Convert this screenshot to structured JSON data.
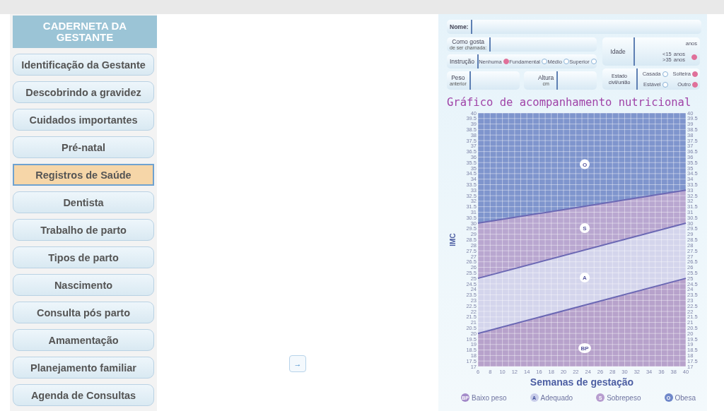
{
  "sidebar": {
    "title": "CADERNETA DA GESTANTE",
    "items": [
      {
        "label": "Identificação da Gestante",
        "selected": false
      },
      {
        "label": "Descobrindo a gravidez",
        "selected": false
      },
      {
        "label": "Cuidados importantes",
        "selected": false
      },
      {
        "label": "Pré-natal",
        "selected": false
      },
      {
        "label": "Registros de Saúde",
        "selected": true
      },
      {
        "label": "Dentista",
        "selected": false
      },
      {
        "label": "Trabalho de parto",
        "selected": false
      },
      {
        "label": "Tipos de parto",
        "selected": false
      },
      {
        "label": "Nascimento",
        "selected": false
      },
      {
        "label": "Consulta pós parto",
        "selected": false
      },
      {
        "label": "Amamentação",
        "selected": false
      },
      {
        "label": "Planejamento familiar",
        "selected": false
      },
      {
        "label": "Agenda de Consultas",
        "selected": false
      }
    ]
  },
  "next_button": {
    "label": "→"
  },
  "form": {
    "name_label": "Nome:",
    "nickname_label": "Como gosta",
    "nickname_sub": "de ser chamada:",
    "education": {
      "label": "Instrução",
      "options": [
        {
          "label": "Nenhuma",
          "marked": true
        },
        {
          "label": "Fundamental",
          "marked": false
        },
        {
          "label": "Médio",
          "marked": false
        },
        {
          "label": "Superior",
          "marked": false
        }
      ]
    },
    "weight_label": "Peso",
    "weight_sub": "anterior",
    "height_label": "Altura",
    "height_sub": "cm",
    "age": {
      "label": "Idade",
      "unit": "anos",
      "risk_low": "<15",
      "risk_high": ">35",
      "risk_unit_1": "anos",
      "risk_unit_2": "anos",
      "marked": true
    },
    "marital": {
      "label_1": "Estado",
      "label_2": "civil/união",
      "options": [
        {
          "label": "Casada",
          "marked": false
        },
        {
          "label": "Solteira",
          "marked": true
        },
        {
          "label": "Estável",
          "marked": false
        },
        {
          "label": "Outro",
          "marked": true
        }
      ]
    }
  },
  "chart": {
    "title": "Gráfico de acompanhamento nutricional",
    "chart_data": {
      "type": "line",
      "xlabel": "Semanas de gestação",
      "ylabel": "IMC",
      "x": [
        6,
        40
      ],
      "series": [
        {
          "color": "#6b68b4",
          "values": [
            20,
            25
          ]
        },
        {
          "color": "#6b68b4",
          "values": [
            25,
            30
          ]
        },
        {
          "color": "#6b68b4",
          "values": [
            30,
            33
          ]
        }
      ],
      "grid": true,
      "xlim": [
        6,
        40
      ],
      "ylim": [
        17,
        40
      ],
      "xticks": [
        6,
        8,
        10,
        12,
        14,
        16,
        18,
        20,
        22,
        24,
        26,
        28,
        30,
        32,
        34,
        36,
        38,
        40
      ],
      "yticks": [
        17,
        17.5,
        18,
        18.5,
        19,
        19.5,
        20,
        20.5,
        21,
        21.5,
        22,
        22.5,
        23,
        23.5,
        24,
        24.5,
        25,
        25.5,
        26,
        26.5,
        27,
        27.5,
        28,
        28.5,
        29,
        29.5,
        30,
        30.5,
        31,
        31.5,
        32,
        32.5,
        33,
        33.5,
        34,
        34.5,
        35,
        35.5,
        36,
        36.5,
        37,
        37.5,
        38,
        38.5,
        39,
        39.5,
        40
      ],
      "annotations": [
        "O",
        "S",
        "A",
        "BP",
        "40",
        "39.5",
        "39",
        "38.5",
        "38",
        "37.5",
        "37",
        "36.5",
        "36",
        "35.5",
        "35",
        "34.5",
        "34",
        "33.5",
        "33",
        "32.5",
        "32",
        "31.5",
        "31",
        "30.5",
        "30",
        "29.5",
        "29",
        "28.5",
        "28",
        "27.5",
        "27",
        "26.5",
        "26",
        "25.5",
        "25",
        "24.5",
        "24",
        "23.5",
        "23",
        "22.5",
        "22",
        "21.5",
        "21",
        "20.5",
        "20",
        "19.5",
        "19",
        "18.5",
        "18",
        "17.5",
        "17"
      ]
    }
  },
  "legend": [
    {
      "badge": "BP",
      "label": "Baixo peso",
      "color": "#a48bc9"
    },
    {
      "badge": "A",
      "label": "Adequado",
      "color": "#c9cdea"
    },
    {
      "badge": "S",
      "label": "Sobrepeso",
      "color": "#b79dcf"
    },
    {
      "badge": "O",
      "label": "Obesa",
      "color": "#6f87c9"
    }
  ]
}
